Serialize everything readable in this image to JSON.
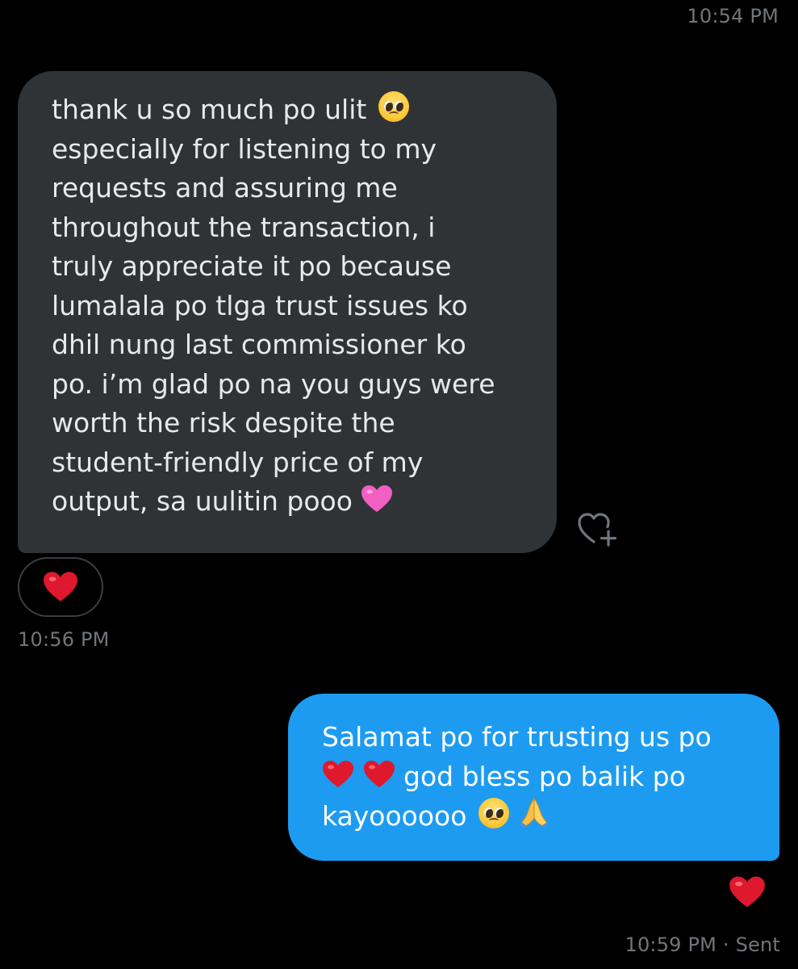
{
  "conversation": {
    "top_timestamp": "10:54 PM",
    "received_message": {
      "lines": [
        "thank u so much po ulit",
        "especially for listening to my",
        "requests and assuring me",
        "throughout the transaction, i",
        "truly appreciate it po because",
        "lumalala po tlga trust issues ko",
        "dhil nung last commissioner ko",
        "po. i’m glad po na you guys were",
        "worth the risk despite the",
        "student-friendly price of my",
        "output, sa uulitin pooo"
      ],
      "emojis": [
        "pleading-face",
        "pink-heart"
      ],
      "reaction": "red-heart",
      "timestamp": "10:56 PM"
    },
    "sent_message": {
      "lines": [
        "Salamat po for trusting us po",
        "god bless po balik po",
        "kayoooooo"
      ],
      "emojis": [
        "red-heart",
        "red-heart",
        "pleading-face",
        "folded-hands"
      ],
      "reaction": "red-heart",
      "timestamp": "10:59 PM",
      "status": "· Sent"
    },
    "icons": {
      "add_reaction": "heart-plus-icon"
    }
  },
  "colors": {
    "background": "#000000",
    "received_bubble": "#2f3336",
    "sent_bubble": "#1d9bf0",
    "timestamp": "#71767b",
    "red_heart": "#e0182d",
    "pink_heart": "#f25fc2"
  }
}
